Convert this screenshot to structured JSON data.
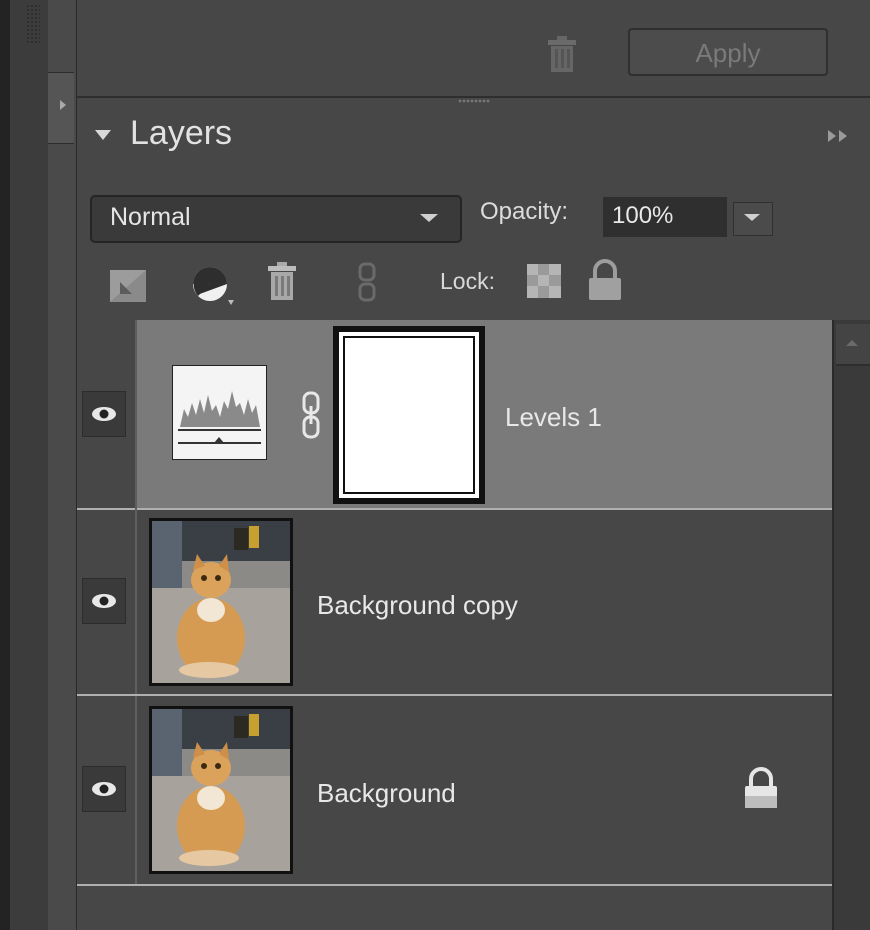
{
  "apply_bar": {
    "apply_label": "Apply",
    "trash_icon": "trash-icon"
  },
  "panel": {
    "title": "Layers",
    "collapse_icon": "triangle-down-icon",
    "more_icon": "double-chevron-right-icon"
  },
  "blend": {
    "mode": "Normal",
    "opacity_label": "Opacity:",
    "opacity_value": "100%"
  },
  "toolbar": {
    "lock_label": "Lock:",
    "icons": [
      "new-layer-icon",
      "adjustment-layer-icon",
      "delete-layer-icon",
      "link-icon",
      "lock-transparency-icon",
      "lock-all-icon"
    ]
  },
  "layers": [
    {
      "name": "Levels 1",
      "selected": true,
      "kind": "adjustment",
      "locked": false
    },
    {
      "name": "Background copy",
      "selected": false,
      "kind": "image",
      "locked": false
    },
    {
      "name": "Background",
      "selected": false,
      "kind": "image",
      "locked": true
    }
  ],
  "colors": {
    "panel_bg": "#474747",
    "selected_row": "#7a7a7a",
    "text": "#e8e8e8"
  }
}
